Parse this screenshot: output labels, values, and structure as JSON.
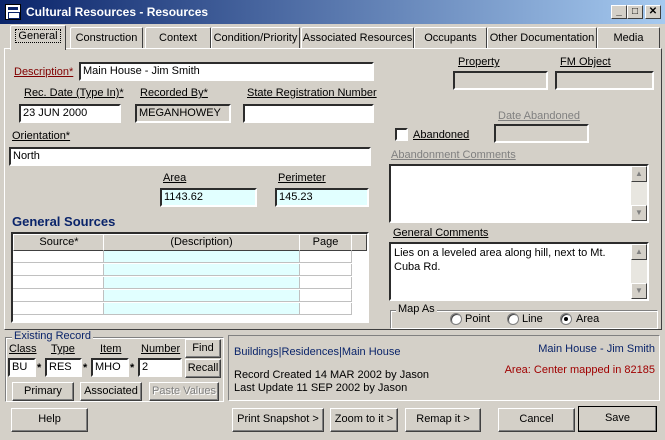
{
  "window": {
    "title": "Cultural Resources - Resources",
    "controls": {
      "minimize": "_",
      "maximize": "□",
      "close": "✕"
    }
  },
  "tabs": [
    "General",
    "Construction",
    "Context",
    "Condition/Priority",
    "Associated Resources",
    "Occupants",
    "Other Documentation",
    "Media"
  ],
  "general": {
    "description_label": "Description*",
    "description_value": "Main House - Jim Smith",
    "rec_date_label": "Rec. Date (Type In)*",
    "rec_date_value": "23 JUN 2000",
    "recorded_by_label": "Recorded By*",
    "recorded_by_value": "MEGANHOWEY",
    "state_reg_label": "State Registration Number",
    "state_reg_value": "",
    "orientation_label": "Orientation*",
    "orientation_value": "North",
    "area_label": "Area",
    "area_value": "1143.62",
    "perimeter_label": "Perimeter",
    "perimeter_value": "145.23",
    "property_label": "Property",
    "fm_object_label": "FM Object",
    "date_abandoned_label": "Date Abandoned",
    "abandoned_label": "Abandoned",
    "abandoned_checked": false,
    "abandonment_comments_label": "Abandonment Comments",
    "general_comments_label": "General Comments",
    "general_comments_value": "Lies on a leveled area along hill, next to Mt. Cuba Rd.",
    "map_as_label": "Map As",
    "map_as_options": [
      "Point",
      "Line",
      "Area"
    ],
    "map_as_selected": "Area"
  },
  "sources": {
    "heading": "General Sources",
    "columns": [
      "Source*",
      "(Description)",
      "Page"
    ]
  },
  "existing_record": {
    "legend": "Existing Record",
    "class_label": "Class",
    "type_label": "Type",
    "item_label": "Item",
    "number_label": "Number",
    "class_value": "BU",
    "type_value": "RES",
    "item_value": "MHO",
    "number_value": "2",
    "separator": "*",
    "find_label": "Find",
    "recall_label": "Recall",
    "primary_label": "Primary",
    "associated_label": "Associated",
    "paste_values_label": "Paste Values"
  },
  "info": {
    "path": "Buildings|Residences|Main House",
    "name": "Main House - Jim Smith",
    "created": "Record Created 14 MAR 2002 by Jason",
    "updated": "Last Update 11 SEP 2002 by Jason",
    "map_status": "Area: Center mapped in 82185"
  },
  "footer": {
    "help": "Help",
    "print_snapshot": "Print Snapshot >",
    "zoom_to_it": "Zoom to it >",
    "remap_it": "Remap it >",
    "cancel": "Cancel",
    "save": "Save"
  },
  "colors": {
    "titlebar_start": "#0a246a",
    "titlebar_end": "#a6caf0",
    "heading_blue": "#0a246a",
    "status_red": "#a00000",
    "cyan_field": "#e1ffff"
  }
}
